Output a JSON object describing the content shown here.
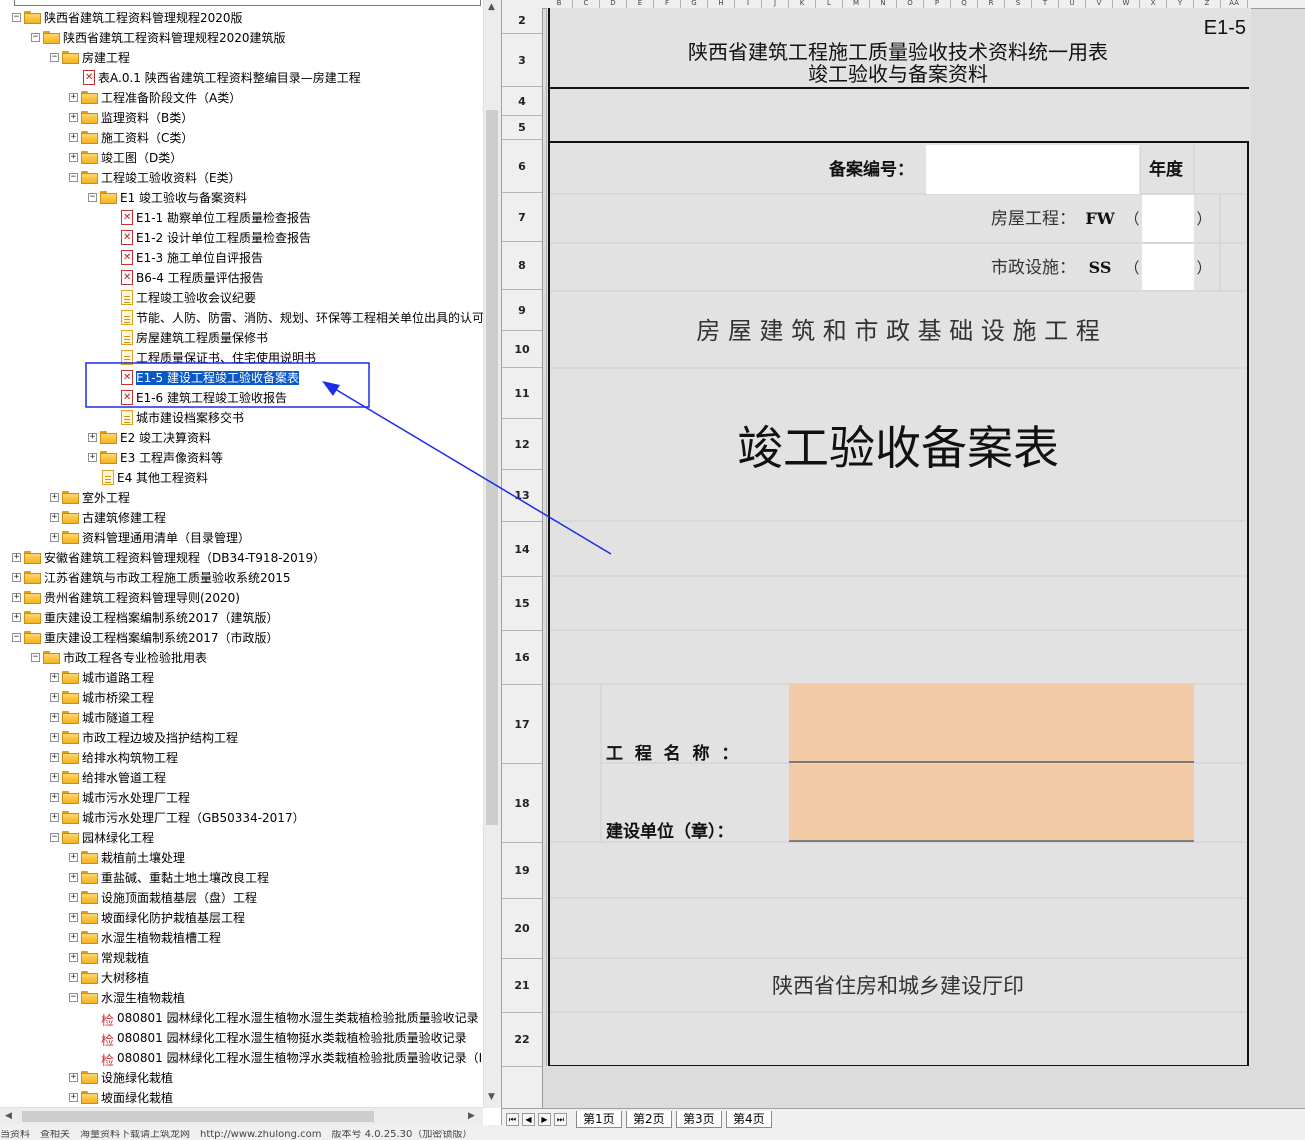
{
  "tree": {
    "rows": [
      {
        "label": "陕西省建筑工程资料管理规程2020版",
        "level": 0,
        "icon": "folder-icon",
        "expand": "-"
      },
      {
        "label": "陕西省建筑工程资料管理规程2020建筑版",
        "level": 1,
        "icon": "folder-icon",
        "expand": "-"
      },
      {
        "label": "房建工程",
        "level": 2,
        "icon": "folder-icon",
        "expand": "-"
      },
      {
        "label": "表A.0.1 陕西省建筑工程资料整编目录—房建工程",
        "level": 3,
        "icon": "pdf-icon",
        "expand": ""
      },
      {
        "label": "工程准备阶段文件（A类）",
        "level": 3,
        "icon": "folder-icon",
        "expand": "+"
      },
      {
        "label": "监理资料（B类）",
        "level": 3,
        "icon": "folder-icon",
        "expand": "+"
      },
      {
        "label": "施工资料（C类）",
        "level": 3,
        "icon": "folder-icon",
        "expand": "+"
      },
      {
        "label": "竣工图（D类）",
        "level": 3,
        "icon": "folder-icon",
        "expand": "+"
      },
      {
        "label": "工程竣工验收资料（E类）",
        "level": 3,
        "icon": "folder-icon",
        "expand": "-"
      },
      {
        "label": "E1 竣工验收与备案资料",
        "level": 4,
        "icon": "folder-icon",
        "expand": "-"
      },
      {
        "label": "E1-1 勘察单位工程质量检查报告",
        "level": 5,
        "icon": "pdf-icon",
        "expand": ""
      },
      {
        "label": "E1-2 设计单位工程质量检查报告",
        "level": 5,
        "icon": "pdf-icon",
        "expand": ""
      },
      {
        "label": "E1-3 施工单位自评报告",
        "level": 5,
        "icon": "pdf-icon",
        "expand": ""
      },
      {
        "label": "B6-4 工程质量评估报告",
        "level": 5,
        "icon": "pdf-icon",
        "expand": ""
      },
      {
        "label": "工程竣工验收会议纪要",
        "level": 5,
        "icon": "doc-icon",
        "expand": ""
      },
      {
        "label": "节能、人防、防雷、消防、规划、环保等工程相关单位出具的认可",
        "level": 5,
        "icon": "doc-icon",
        "expand": ""
      },
      {
        "label": "房屋建筑工程质量保修书",
        "level": 5,
        "icon": "doc-icon",
        "expand": ""
      },
      {
        "label": "工程质量保证书、住宅使用说明书",
        "level": 5,
        "icon": "doc-icon",
        "expand": ""
      },
      {
        "label": "E1-5 建设工程竣工验收备案表",
        "level": 5,
        "icon": "pdf-icon",
        "expand": "",
        "selected": true
      },
      {
        "label": "E1-6 建筑工程竣工验收报告",
        "level": 5,
        "icon": "pdf-icon",
        "expand": ""
      },
      {
        "label": "城市建设档案移交书",
        "level": 5,
        "icon": "doc-icon",
        "expand": ""
      },
      {
        "label": "E2 竣工决算资料",
        "level": 4,
        "icon": "folder-icon",
        "expand": "+"
      },
      {
        "label": "E3 工程声像资料等",
        "level": 4,
        "icon": "folder-icon",
        "expand": "+"
      },
      {
        "label": "E4 其他工程资料",
        "level": 4,
        "icon": "doc-icon",
        "expand": ""
      },
      {
        "label": "室外工程",
        "level": 2,
        "icon": "folder-icon",
        "expand": "+"
      },
      {
        "label": "古建筑修建工程",
        "level": 2,
        "icon": "folder-icon",
        "expand": "+"
      },
      {
        "label": "资料管理通用清单（目录管理）",
        "level": 2,
        "icon": "folder-icon",
        "expand": "+"
      },
      {
        "label": "安徽省建筑工程资料管理规程（DB34-T918-2019）",
        "level": 0,
        "icon": "folder-icon",
        "expand": "+"
      },
      {
        "label": "江苏省建筑与市政工程施工质量验收系统2015",
        "level": 0,
        "icon": "folder-icon",
        "expand": "+"
      },
      {
        "label": "贵州省建筑工程资料管理导则(2020)",
        "level": 0,
        "icon": "folder-icon",
        "expand": "+"
      },
      {
        "label": "重庆建设工程档案编制系统2017（建筑版）",
        "level": 0,
        "icon": "folder-icon",
        "expand": "+"
      },
      {
        "label": "重庆建设工程档案编制系统2017（市政版）",
        "level": 0,
        "icon": "folder-icon",
        "expand": "-"
      },
      {
        "label": "市政工程各专业检验批用表",
        "level": 1,
        "icon": "folder-icon",
        "expand": "-"
      },
      {
        "label": "城市道路工程",
        "level": 2,
        "icon": "folder-icon",
        "expand": "+"
      },
      {
        "label": "城市桥梁工程",
        "level": 2,
        "icon": "folder-icon",
        "expand": "+"
      },
      {
        "label": "城市隧道工程",
        "level": 2,
        "icon": "folder-icon",
        "expand": "+"
      },
      {
        "label": "市政工程边坡及挡护结构工程",
        "level": 2,
        "icon": "folder-icon",
        "expand": "+"
      },
      {
        "label": "给排水构筑物工程",
        "level": 2,
        "icon": "folder-icon",
        "expand": "+"
      },
      {
        "label": "给排水管道工程",
        "level": 2,
        "icon": "folder-icon",
        "expand": "+"
      },
      {
        "label": "城市污水处理厂工程",
        "level": 2,
        "icon": "folder-icon",
        "expand": "+"
      },
      {
        "label": "城市污水处理厂工程（GB50334-2017）",
        "level": 2,
        "icon": "folder-icon",
        "expand": "+"
      },
      {
        "label": "园林绿化工程",
        "level": 2,
        "icon": "folder-icon",
        "expand": "-"
      },
      {
        "label": "栽植前土壤处理",
        "level": 3,
        "icon": "folder-icon",
        "expand": "+"
      },
      {
        "label": "重盐碱、重黏土地土壤改良工程",
        "level": 3,
        "icon": "folder-icon",
        "expand": "+"
      },
      {
        "label": "设施顶面栽植基层（盘）工程",
        "level": 3,
        "icon": "folder-icon",
        "expand": "+"
      },
      {
        "label": "坡面绿化防护栽植基层工程",
        "level": 3,
        "icon": "folder-icon",
        "expand": "+"
      },
      {
        "label": "水湿生植物栽植槽工程",
        "level": 3,
        "icon": "folder-icon",
        "expand": "+"
      },
      {
        "label": "常规栽植",
        "level": 3,
        "icon": "folder-icon",
        "expand": "+"
      },
      {
        "label": "大树移植",
        "level": 3,
        "icon": "folder-icon",
        "expand": "+"
      },
      {
        "label": "水湿生植物栽植",
        "level": 3,
        "icon": "folder-icon",
        "expand": "-"
      },
      {
        "label": "080801 园林绿化工程水湿生植物水湿生类栽植检验批质量验收记录",
        "level": 4,
        "icon": "inspection-icon",
        "expand": ""
      },
      {
        "label": "080801 园林绿化工程水湿生植物挺水类栽植检验批质量验收记录",
        "level": 4,
        "icon": "inspection-icon",
        "expand": ""
      },
      {
        "label": "080801 园林绿化工程水湿生植物浮水类栽植检验批质量验收记录（I",
        "level": 4,
        "icon": "inspection-icon",
        "expand": ""
      },
      {
        "label": "设施绿化栽植",
        "level": 3,
        "icon": "folder-icon",
        "expand": "+"
      },
      {
        "label": "坡面绿化栽植",
        "level": 3,
        "icon": "folder-icon",
        "expand": "+"
      }
    ],
    "inspection_glyph": "检"
  },
  "sheet": {
    "columns": [
      "B",
      "C",
      "D",
      "E",
      "F",
      "G",
      "H",
      "I",
      "J",
      "K",
      "L",
      "M",
      "N",
      "O",
      "P",
      "Q",
      "R",
      "S",
      "T",
      "U",
      "V",
      "W",
      "X",
      "Y",
      "Z",
      "AA"
    ],
    "rows": [
      "2",
      "3",
      "4",
      "5",
      "6",
      "7",
      "8",
      "9",
      "10",
      "11",
      "12",
      "13",
      "14",
      "15",
      "16",
      "17",
      "18",
      "19",
      "20",
      "21",
      "22"
    ],
    "form_code": "E1-5",
    "header_title_1": "陕西省建筑工程施工质量验收技术资料统一用表",
    "header_title_2": "竣工验收与备案资料",
    "record_no_label": "备案编号：",
    "year_label": "年度",
    "housing_label": "房屋工程：",
    "housing_code": "FW",
    "municipal_label": "市政设施：",
    "municipal_code": "SS",
    "paren_open": "（",
    "paren_close": "）",
    "subtitle": "房 屋 建 筑 和 市 政 基 础 设 施 工 程",
    "main_title": "竣工验收备案表",
    "project_name_label": "工  程  名  称  ：",
    "builder_label": "建设单位（章）：",
    "footer": "陕西省住房和城乡建设厅印",
    "input_fill": "#f2caa6"
  },
  "tabs": [
    "第1页",
    "第2页",
    "第3页",
    "第4页"
  ],
  "nav_buttons": [
    "⏮",
    "◀",
    "▶",
    "⏭"
  ],
  "status_text": "当资料　查相关　海量资料下载请上筑龙网　http://www.zhulong.com　版本号 4.0.25.30（加密锁版）",
  "annotation": {
    "color": "#1a2ee8"
  }
}
